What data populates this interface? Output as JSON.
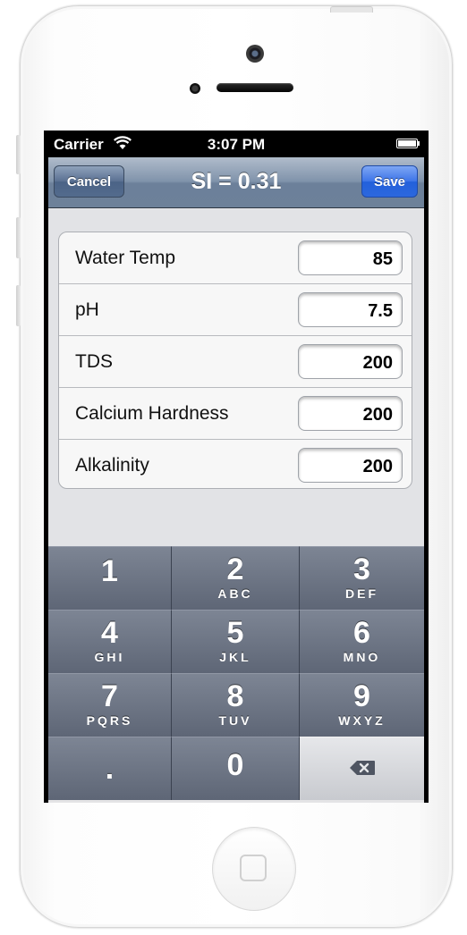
{
  "status_bar": {
    "carrier": "Carrier",
    "time": "3:07 PM"
  },
  "nav": {
    "cancel_label": "Cancel",
    "title": "SI = 0.31",
    "save_label": "Save"
  },
  "form": {
    "rows": [
      {
        "label": "Water Temp",
        "value": "85"
      },
      {
        "label": "pH",
        "value": "7.5"
      },
      {
        "label": "TDS",
        "value": "200"
      },
      {
        "label": "Calcium Hardness",
        "value": "200"
      },
      {
        "label": "Alkalinity",
        "value": "200"
      }
    ]
  },
  "keypad": {
    "keys": [
      {
        "digit": "1",
        "letters": ""
      },
      {
        "digit": "2",
        "letters": "ABC"
      },
      {
        "digit": "3",
        "letters": "DEF"
      },
      {
        "digit": "4",
        "letters": "GHI"
      },
      {
        "digit": "5",
        "letters": "JKL"
      },
      {
        "digit": "6",
        "letters": "MNO"
      },
      {
        "digit": "7",
        "letters": "PQRS"
      },
      {
        "digit": "8",
        "letters": "TUV"
      },
      {
        "digit": "9",
        "letters": "WXYZ"
      },
      {
        "digit": ".",
        "letters": ""
      },
      {
        "digit": "0",
        "letters": ""
      }
    ],
    "delete_icon": "backspace-icon"
  },
  "colors": {
    "nav_bar": "#7085a0",
    "save_button": "#2c68de",
    "keypad": "#5e6676"
  }
}
